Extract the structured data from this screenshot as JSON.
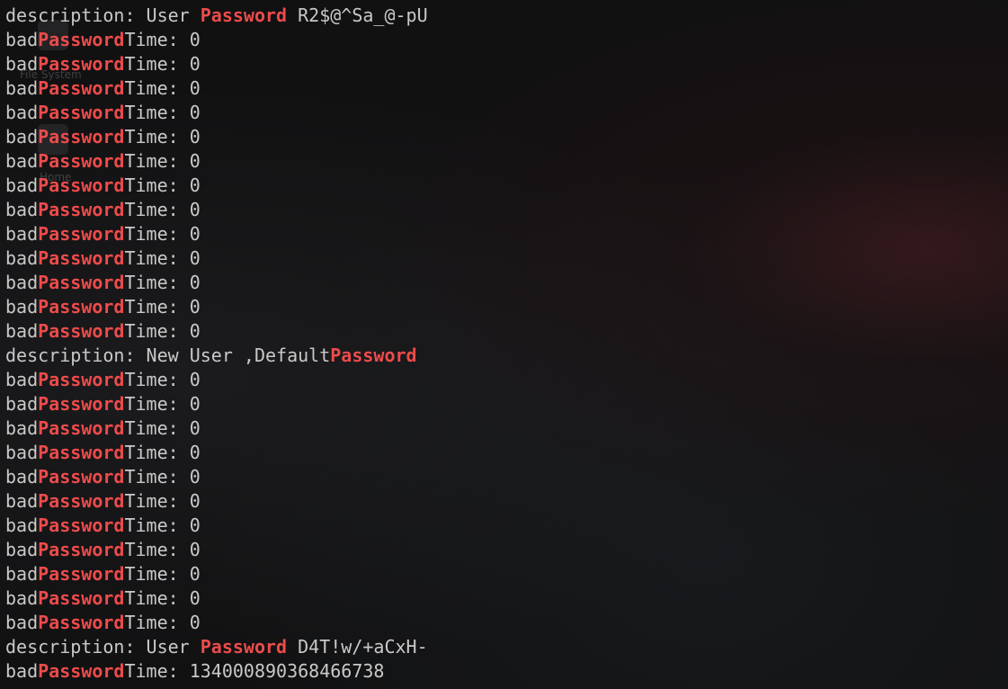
{
  "desktop": {
    "icons": [
      {
        "label": "File System",
        "icon": "drive-icon"
      },
      {
        "label": "Home",
        "icon": "home-folder-icon"
      }
    ]
  },
  "terminal": {
    "highlight_color": "#ee4b4b",
    "text_color": "#c9c9c9",
    "lines": [
      {
        "parts": [
          {
            "text": "description: User ",
            "hl": false
          },
          {
            "text": "Password",
            "hl": true
          },
          {
            "text": " R2$@^Sa_@-pU",
            "hl": false
          }
        ]
      },
      {
        "parts": [
          {
            "text": "bad",
            "hl": false
          },
          {
            "text": "Password",
            "hl": true
          },
          {
            "text": "Time: 0",
            "hl": false
          }
        ]
      },
      {
        "parts": [
          {
            "text": "bad",
            "hl": false
          },
          {
            "text": "Password",
            "hl": true
          },
          {
            "text": "Time: 0",
            "hl": false
          }
        ]
      },
      {
        "parts": [
          {
            "text": "bad",
            "hl": false
          },
          {
            "text": "Password",
            "hl": true
          },
          {
            "text": "Time: 0",
            "hl": false
          }
        ]
      },
      {
        "parts": [
          {
            "text": "bad",
            "hl": false
          },
          {
            "text": "Password",
            "hl": true
          },
          {
            "text": "Time: 0",
            "hl": false
          }
        ]
      },
      {
        "parts": [
          {
            "text": "bad",
            "hl": false
          },
          {
            "text": "Password",
            "hl": true
          },
          {
            "text": "Time: 0",
            "hl": false
          }
        ]
      },
      {
        "parts": [
          {
            "text": "bad",
            "hl": false
          },
          {
            "text": "Password",
            "hl": true
          },
          {
            "text": "Time: 0",
            "hl": false
          }
        ]
      },
      {
        "parts": [
          {
            "text": "bad",
            "hl": false
          },
          {
            "text": "Password",
            "hl": true
          },
          {
            "text": "Time: 0",
            "hl": false
          }
        ]
      },
      {
        "parts": [
          {
            "text": "bad",
            "hl": false
          },
          {
            "text": "Password",
            "hl": true
          },
          {
            "text": "Time: 0",
            "hl": false
          }
        ]
      },
      {
        "parts": [
          {
            "text": "bad",
            "hl": false
          },
          {
            "text": "Password",
            "hl": true
          },
          {
            "text": "Time: 0",
            "hl": false
          }
        ]
      },
      {
        "parts": [
          {
            "text": "bad",
            "hl": false
          },
          {
            "text": "Password",
            "hl": true
          },
          {
            "text": "Time: 0",
            "hl": false
          }
        ]
      },
      {
        "parts": [
          {
            "text": "bad",
            "hl": false
          },
          {
            "text": "Password",
            "hl": true
          },
          {
            "text": "Time: 0",
            "hl": false
          }
        ]
      },
      {
        "parts": [
          {
            "text": "bad",
            "hl": false
          },
          {
            "text": "Password",
            "hl": true
          },
          {
            "text": "Time: 0",
            "hl": false
          }
        ]
      },
      {
        "parts": [
          {
            "text": "bad",
            "hl": false
          },
          {
            "text": "Password",
            "hl": true
          },
          {
            "text": "Time: 0",
            "hl": false
          }
        ]
      },
      {
        "parts": [
          {
            "text": "description: New User ,Default",
            "hl": false
          },
          {
            "text": "Password",
            "hl": true
          }
        ]
      },
      {
        "parts": [
          {
            "text": "bad",
            "hl": false
          },
          {
            "text": "Password",
            "hl": true
          },
          {
            "text": "Time: 0",
            "hl": false
          }
        ]
      },
      {
        "parts": [
          {
            "text": "bad",
            "hl": false
          },
          {
            "text": "Password",
            "hl": true
          },
          {
            "text": "Time: 0",
            "hl": false
          }
        ]
      },
      {
        "parts": [
          {
            "text": "bad",
            "hl": false
          },
          {
            "text": "Password",
            "hl": true
          },
          {
            "text": "Time: 0",
            "hl": false
          }
        ]
      },
      {
        "parts": [
          {
            "text": "bad",
            "hl": false
          },
          {
            "text": "Password",
            "hl": true
          },
          {
            "text": "Time: 0",
            "hl": false
          }
        ]
      },
      {
        "parts": [
          {
            "text": "bad",
            "hl": false
          },
          {
            "text": "Password",
            "hl": true
          },
          {
            "text": "Time: 0",
            "hl": false
          }
        ]
      },
      {
        "parts": [
          {
            "text": "bad",
            "hl": false
          },
          {
            "text": "Password",
            "hl": true
          },
          {
            "text": "Time: 0",
            "hl": false
          }
        ]
      },
      {
        "parts": [
          {
            "text": "bad",
            "hl": false
          },
          {
            "text": "Password",
            "hl": true
          },
          {
            "text": "Time: 0",
            "hl": false
          }
        ]
      },
      {
        "parts": [
          {
            "text": "bad",
            "hl": false
          },
          {
            "text": "Password",
            "hl": true
          },
          {
            "text": "Time: 0",
            "hl": false
          }
        ]
      },
      {
        "parts": [
          {
            "text": "bad",
            "hl": false
          },
          {
            "text": "Password",
            "hl": true
          },
          {
            "text": "Time: 0",
            "hl": false
          }
        ]
      },
      {
        "parts": [
          {
            "text": "bad",
            "hl": false
          },
          {
            "text": "Password",
            "hl": true
          },
          {
            "text": "Time: 0",
            "hl": false
          }
        ]
      },
      {
        "parts": [
          {
            "text": "bad",
            "hl": false
          },
          {
            "text": "Password",
            "hl": true
          },
          {
            "text": "Time: 0",
            "hl": false
          }
        ]
      },
      {
        "parts": [
          {
            "text": "description: User ",
            "hl": false
          },
          {
            "text": "Password",
            "hl": true
          },
          {
            "text": " D4T!w/+aCxH-",
            "hl": false
          }
        ]
      },
      {
        "parts": [
          {
            "text": "bad",
            "hl": false
          },
          {
            "text": "Password",
            "hl": true
          },
          {
            "text": "Time: 134000890368466738",
            "hl": false
          }
        ]
      }
    ]
  }
}
